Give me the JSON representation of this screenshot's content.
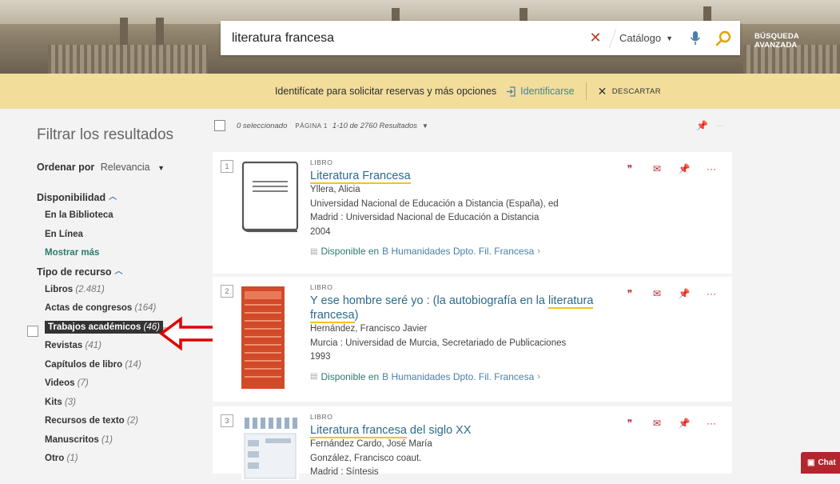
{
  "search": {
    "query": "literatura francesa",
    "scope": "Catálogo",
    "advanced_label": "BÚSQUEDA AVANZADA"
  },
  "loginbar": {
    "message": "Identifícate para solicitar reservas y más opciones",
    "login_label": "Identificarse",
    "dismiss_label": "DESCARTAR"
  },
  "sidebar": {
    "title": "Filtrar los resultados",
    "sort_label": "Ordenar por",
    "sort_value": "Relevancia",
    "availability_heading": "Disponibilidad",
    "availability": [
      {
        "label": "En la Biblioteca"
      },
      {
        "label": "En Línea"
      }
    ],
    "show_more": "Mostrar más",
    "type_heading": "Tipo de recurso",
    "types": [
      {
        "label": "Libros",
        "count": "(2.481)"
      },
      {
        "label": "Actas de congresos",
        "count": "(164)"
      },
      {
        "label": "Trabajos académicos",
        "count": "(46)"
      },
      {
        "label": "Revistas",
        "count": "(41)"
      },
      {
        "label": "Capítulos de libro",
        "count": "(14)"
      },
      {
        "label": "Videos",
        "count": "(7)"
      },
      {
        "label": "Kits",
        "count": "(3)"
      },
      {
        "label": "Recursos de texto",
        "count": "(2)"
      },
      {
        "label": "Manuscritos",
        "count": "(1)"
      },
      {
        "label": "Otro",
        "count": "(1)"
      }
    ]
  },
  "results_header": {
    "selected": "0 seleccionado",
    "page": "PÁGINA 1",
    "range": "1-10 de 2760 Resultados"
  },
  "results": [
    {
      "num": "1",
      "type": "LIBRO",
      "title": "Literatura Francesa",
      "author": "Yllera, Alicia",
      "lines": [
        "Universidad Nacional de Educación a Distancia (España), ed",
        "Madrid : Universidad Nacional de Educación a Distancia",
        "2004"
      ],
      "avail": "Disponible en",
      "location": "B Humanidades  Dpto. Fil. Francesa"
    },
    {
      "num": "2",
      "type": "LIBRO",
      "title_pre": "Y ese hombre seré yo : (la autobiografía en la ",
      "title_mark1": "literatura",
      "title_mark2": "francesa",
      "title_post": ")",
      "author": "Hernández, Francisco Javier",
      "lines": [
        "Murcia : Universidad de Murcia, Secretariado de Publicaciones",
        "1993"
      ],
      "avail": "Disponible en",
      "location": "B Humanidades  Dpto. Fil. Francesa"
    },
    {
      "num": "3",
      "type": "LIBRO",
      "title_mark": "Literatura francesa",
      "title_post": " del siglo XX",
      "author": "Fernández Cardo, José María",
      "lines": [
        "González, Francisco coaut.",
        "Madrid : Síntesis"
      ]
    }
  ],
  "chat_label": "Chat",
  "colors": {
    "accent_red": "#b3262f",
    "link_blue": "#2c6b8a",
    "avail_green": "#2c7a6d",
    "login_bar": "#f2dd9a"
  }
}
